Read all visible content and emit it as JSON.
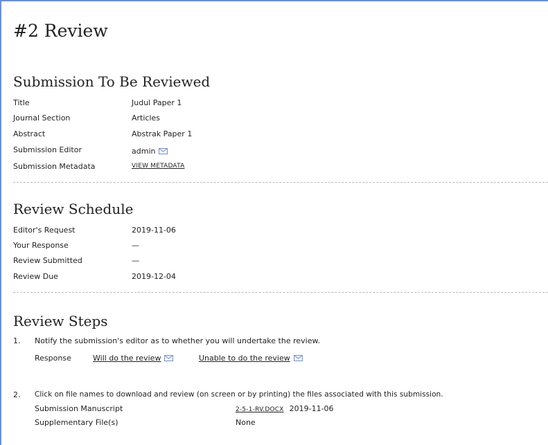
{
  "page_title": "#2 Review",
  "submission": {
    "heading": "Submission To Be Reviewed",
    "title_label": "Title",
    "title_value": "Judul Paper 1",
    "section_label": "Journal Section",
    "section_value": "Articles",
    "abstract_label": "Abstract",
    "abstract_value": "Abstrak Paper 1",
    "editor_label": "Submission Editor",
    "editor_value": "admin",
    "metadata_label": "Submission Metadata",
    "metadata_link": "VIEW METADATA"
  },
  "schedule": {
    "heading": "Review Schedule",
    "rows": [
      {
        "label": "Editor's Request",
        "value": "2019-11-06"
      },
      {
        "label": "Your Response",
        "value": "—"
      },
      {
        "label": "Review Submitted",
        "value": "—"
      },
      {
        "label": "Review Due",
        "value": "2019-12-04"
      }
    ]
  },
  "steps": {
    "heading": "Review Steps",
    "step1": {
      "number": "1.",
      "text": "Notify the submission's editor as to whether you will undertake the review.",
      "response_label": "Response",
      "accept_link": "Will do the review",
      "decline_link": "Unable to do the review"
    },
    "step2": {
      "number": "2.",
      "text": "Click on file names to download and review (on screen or by printing) the files associated with this submission.",
      "manuscript_label": "Submission Manuscript",
      "manuscript_file": "2-5-1-RV.DOCX",
      "manuscript_date": "2019-11-06",
      "supp_label": "Supplementary File(s)",
      "supp_value": "None"
    }
  },
  "icons": {
    "email": "envelope-icon"
  }
}
